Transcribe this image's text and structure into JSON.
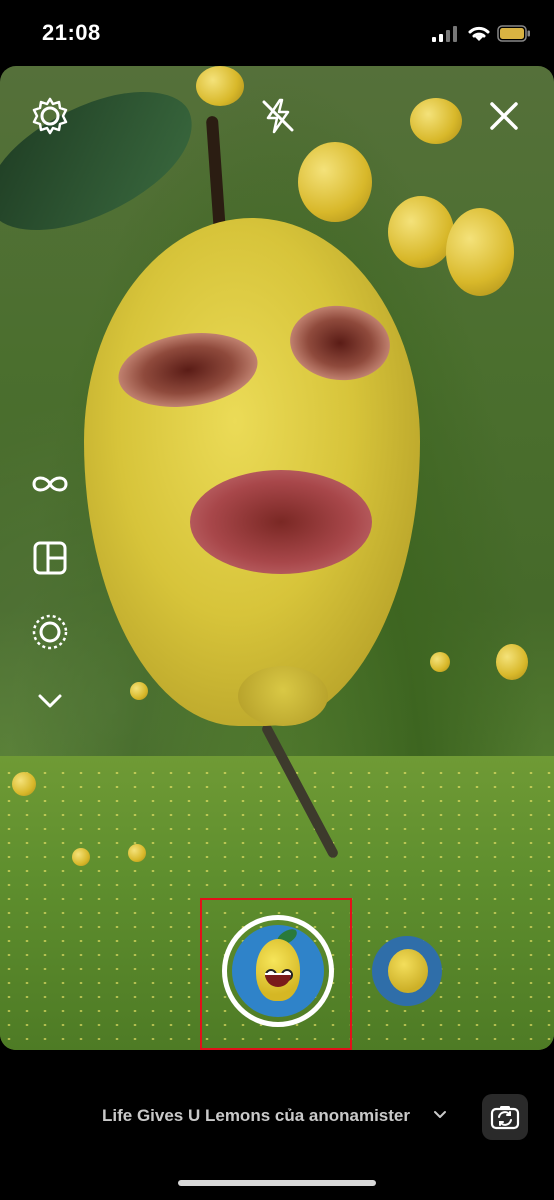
{
  "status_bar": {
    "time": "21:08",
    "battery_color": "#d9b342"
  },
  "camera": {
    "effect_name": "Life Gives U Lemons của anonamister",
    "icons": {
      "settings": "settings-icon",
      "flash_off": "flash-off-icon",
      "close": "close-icon",
      "boomerang": "infinity-icon",
      "layout": "layout-icon",
      "lens": "lens-icon",
      "more": "chevron-down-icon",
      "flip": "flip-camera-icon"
    },
    "effects": [
      {
        "name": "life-gives-u-lemons",
        "selected": true
      },
      {
        "name": "lemon-effect",
        "selected": false
      }
    ],
    "highlight_color": "#e3101a"
  }
}
